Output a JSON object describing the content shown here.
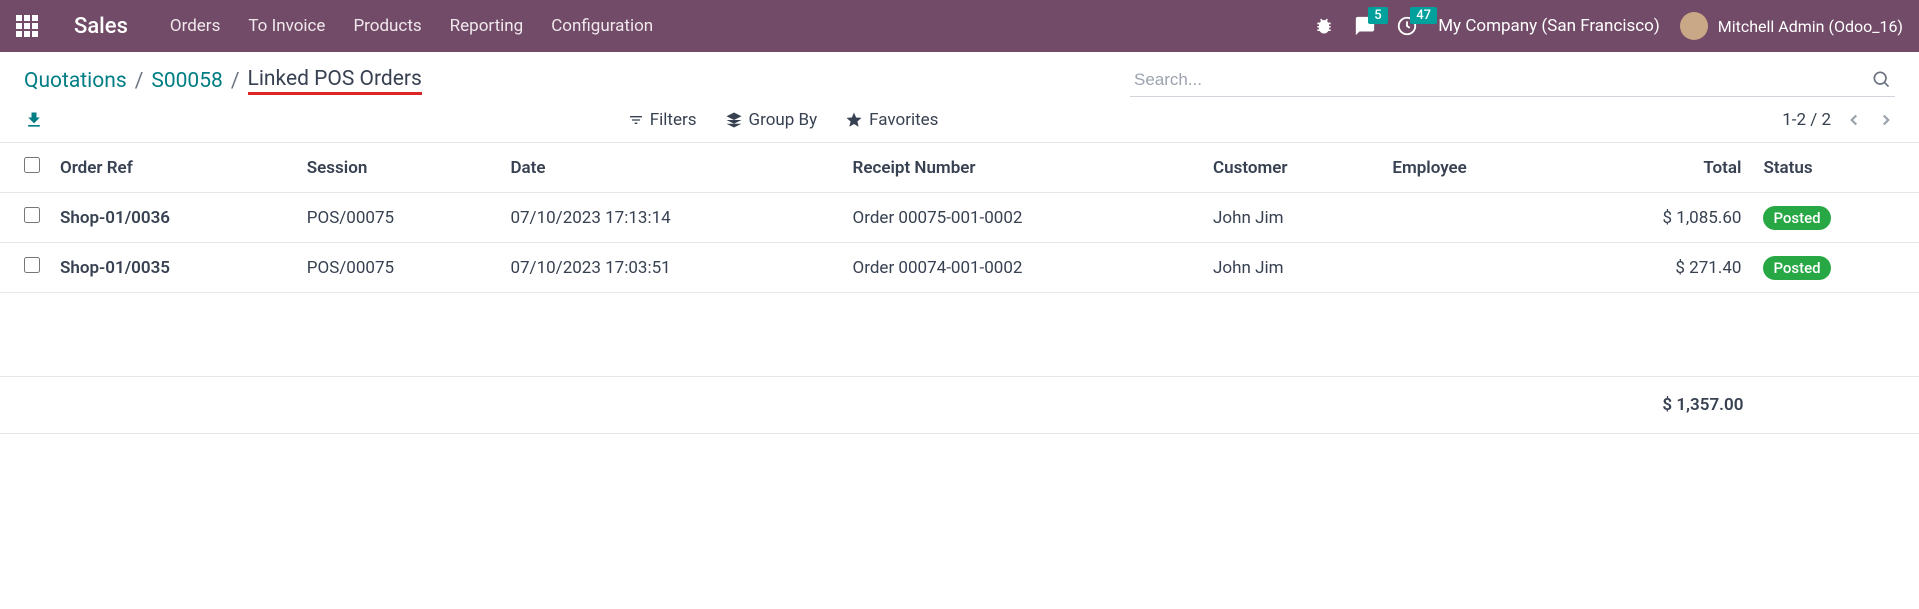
{
  "navbar": {
    "brand": "Sales",
    "items": [
      "Orders",
      "To Invoice",
      "Products",
      "Reporting",
      "Configuration"
    ],
    "chat_count": "5",
    "activity_count": "47",
    "company": "My Company (San Francisco)",
    "user": "Mitchell Admin (Odoo_16)"
  },
  "breadcrumb": {
    "root": "Quotations",
    "mid": "S00058",
    "current": "Linked POS Orders"
  },
  "search": {
    "placeholder": "Search..."
  },
  "filters": {
    "filters_label": "Filters",
    "group_by_label": "Group By",
    "favorites_label": "Favorites"
  },
  "pager": {
    "text": "1-2 / 2"
  },
  "table": {
    "headers": {
      "order_ref": "Order Ref",
      "session": "Session",
      "date": "Date",
      "receipt": "Receipt Number",
      "customer": "Customer",
      "employee": "Employee",
      "total": "Total",
      "status": "Status"
    },
    "rows": [
      {
        "ref": "Shop-01/0036",
        "session": "POS/00075",
        "date": "07/10/2023 17:13:14",
        "receipt": "Order 00075-001-0002",
        "customer": "John Jim",
        "employee": "",
        "total": "$ 1,085.60",
        "status": "Posted"
      },
      {
        "ref": "Shop-01/0035",
        "session": "POS/00075",
        "date": "07/10/2023 17:03:51",
        "receipt": "Order 00074-001-0002",
        "customer": "John Jim",
        "employee": "",
        "total": "$ 271.40",
        "status": "Posted"
      }
    ],
    "footer_total": "$ 1,357.00"
  }
}
